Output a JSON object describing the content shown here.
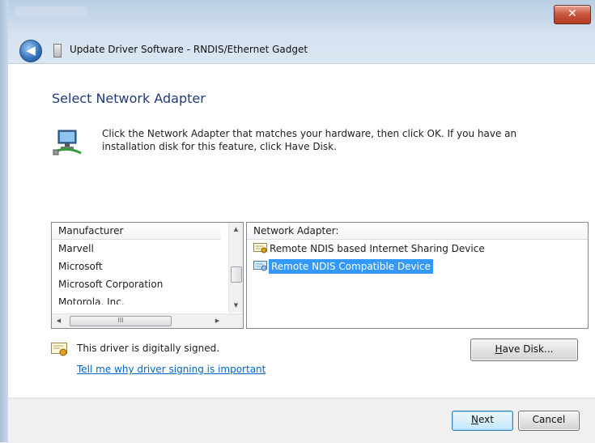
{
  "window": {
    "title": "Update Driver Software - RNDIS/Ethernet Gadget",
    "close_glyph": "✕",
    "back_glyph": "◀"
  },
  "page": {
    "heading": "Select Network Adapter",
    "instruction": "Click the Network Adapter that matches your hardware, then click OK. If you have an installation disk for this feature, click Have Disk."
  },
  "manufacturer_list": {
    "header": "Manufacturer",
    "items": [
      "Marvell",
      "Microsoft",
      "Microsoft Corporation",
      "Motorola, Inc."
    ],
    "hscroll_grip": "III"
  },
  "adapter_list": {
    "header": "Network Adapter:",
    "items": [
      {
        "label": "Remote NDIS based Internet Sharing Device",
        "selected": false
      },
      {
        "label": "Remote NDIS Compatible Device",
        "selected": true
      }
    ]
  },
  "signing": {
    "status": "This driver is digitally signed.",
    "link": "Tell me why driver signing is important"
  },
  "buttons": {
    "have_disk_access": "H",
    "have_disk_rest": "ave Disk...",
    "next_access": "N",
    "next_rest": "ext",
    "cancel": "Cancel"
  },
  "colors": {
    "heading": "#1f3b7a",
    "selection": "#3399ff",
    "link": "#0066cc"
  },
  "icons": {
    "back": "back-arrow-icon",
    "close": "close-icon",
    "network": "network-adapter-icon",
    "certificate": "certificate-icon"
  }
}
